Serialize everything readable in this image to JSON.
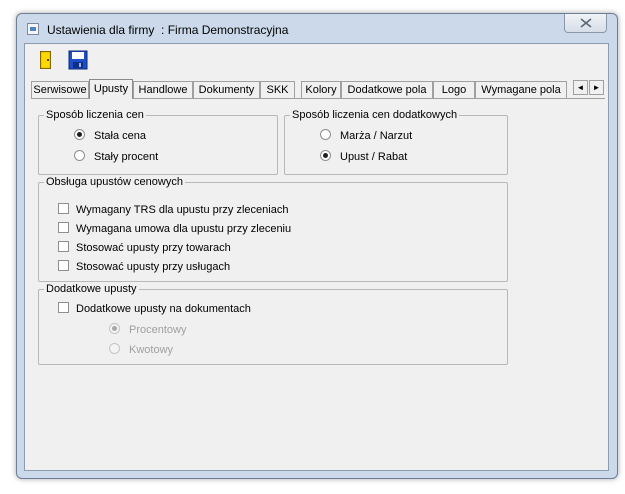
{
  "window": {
    "title": "Ustawienia dla firmy  : Firma Demonstracyjna"
  },
  "toolbar": {
    "exit_icon": "door-exit-icon",
    "save_icon": "floppy-save-icon"
  },
  "tabs": [
    {
      "label": "Serwisowe",
      "active": false
    },
    {
      "label": "Upusty",
      "active": true
    },
    {
      "label": "Handlowe",
      "active": false
    },
    {
      "label": "Dokumenty",
      "active": false
    },
    {
      "label": "SKK",
      "active": false
    },
    {
      "label": "Kolory",
      "active": false
    },
    {
      "label": "Dodatkowe pola",
      "active": false
    },
    {
      "label": "Logo",
      "active": false
    },
    {
      "label": "Wymagane pola",
      "active": false
    }
  ],
  "tab_scroll": {
    "left": "◄",
    "right": "►"
  },
  "pricing_method": {
    "legend": "Sposób liczenia cen",
    "options": [
      {
        "label": "Stała cena",
        "checked": true
      },
      {
        "label": "Stały procent",
        "checked": false
      }
    ]
  },
  "additional_pricing_method": {
    "legend": "Sposób liczenia cen dodatkowych",
    "options": [
      {
        "label": "Marża / Narzut",
        "checked": false
      },
      {
        "label": "Upust / Rabat",
        "checked": true
      }
    ]
  },
  "price_discounts": {
    "legend": "Obsługa upustów cenowych",
    "options": [
      {
        "label": "Wymagany TRS dla upustu przy zleceniach",
        "checked": false
      },
      {
        "label": "Wymagana umowa dla upustu przy zleceniu",
        "checked": false
      },
      {
        "label": "Stosować upusty przy towarach",
        "checked": false
      },
      {
        "label": "Stosować upusty przy usługach",
        "checked": false
      }
    ]
  },
  "additional_discounts": {
    "legend": "Dodatkowe upusty",
    "checkbox": {
      "label": "Dodatkowe upusty na dokumentach",
      "checked": false
    },
    "options": [
      {
        "label": "Procentowy",
        "checked": true,
        "enabled": false
      },
      {
        "label": "Kwotowy",
        "checked": false,
        "enabled": false
      }
    ]
  }
}
